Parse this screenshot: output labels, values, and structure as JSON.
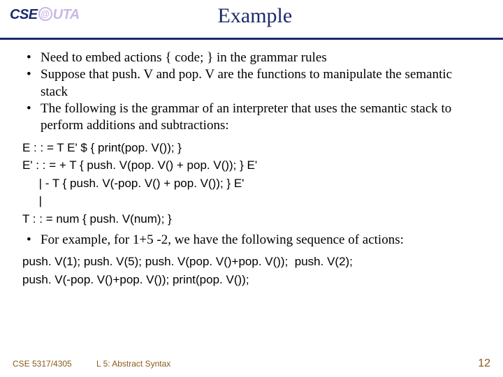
{
  "logo": {
    "left": "CSE",
    "at": "@",
    "right": "UTA"
  },
  "title": "Example",
  "bullets1": [
    "Need to embed actions  { code; }  in the grammar rules",
    "Suppose that push. V and pop. V are the functions to manipulate the semantic stack",
    "The following is the grammar of an interpreter that uses the semantic stack to perform additions and subtractions:"
  ],
  "grammar": [
    "E : : = T E' $ { print(pop. V()); }",
    "E' : : = + T { push. V(pop. V() + pop. V()); } E'",
    "     | - T { push. V(-pop. V() + pop. V()); } E'",
    "     |",
    "T : : = num { push. V(num); }"
  ],
  "bullets2": [
    "For example, for 1+5 -2, we have the following sequence of actions:"
  ],
  "actions": [
    "push. V(1); push. V(5); push. V(pop. V()+pop. V());  push. V(2);",
    "push. V(-pop. V()+pop. V()); print(pop. V());"
  ],
  "footer": {
    "course": "CSE 5317/4305",
    "lecture": "L 5: Abstract Syntax",
    "page": "12"
  }
}
